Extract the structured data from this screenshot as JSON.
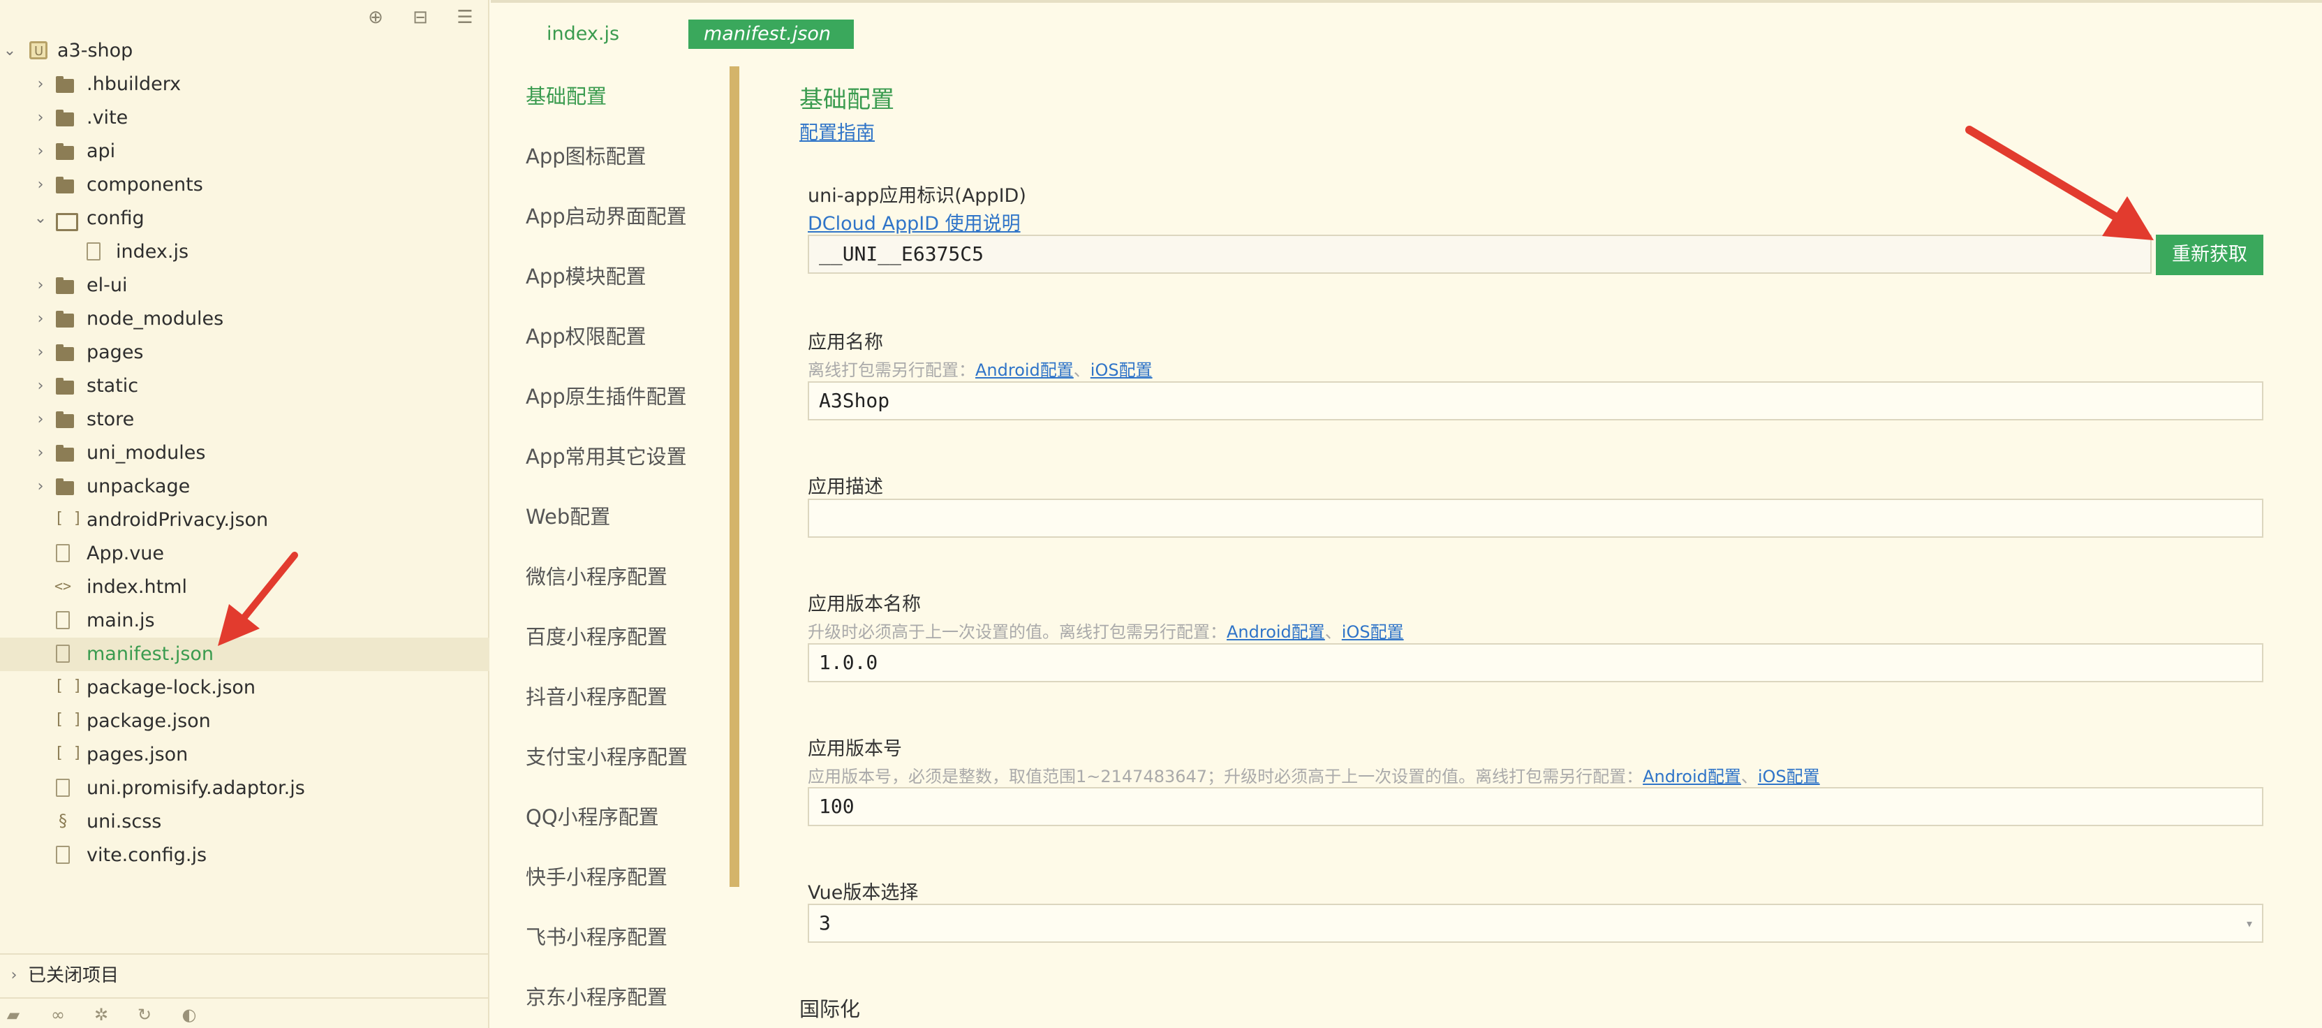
{
  "sidebar": {
    "toolbar_icons": [
      "crosshair-icon",
      "collapse-icon",
      "menu-icon"
    ],
    "tree": [
      {
        "label": "a3-shop",
        "type": "project",
        "depth": 0,
        "expanded": true
      },
      {
        "label": ".hbuilderx",
        "type": "folder",
        "depth": 1
      },
      {
        "label": ".vite",
        "type": "folder",
        "depth": 1
      },
      {
        "label": "api",
        "type": "folder",
        "depth": 1
      },
      {
        "label": "components",
        "type": "folder",
        "depth": 1
      },
      {
        "label": "config",
        "type": "folder",
        "depth": 1,
        "expanded": true
      },
      {
        "label": "index.js",
        "type": "js",
        "depth": 2
      },
      {
        "label": "el-ui",
        "type": "folder",
        "depth": 1
      },
      {
        "label": "node_modules",
        "type": "folder",
        "depth": 1
      },
      {
        "label": "pages",
        "type": "folder",
        "depth": 1
      },
      {
        "label": "static",
        "type": "folder",
        "depth": 1
      },
      {
        "label": "store",
        "type": "folder",
        "depth": 1
      },
      {
        "label": "uni_modules",
        "type": "folder",
        "depth": 1
      },
      {
        "label": "unpackage",
        "type": "folder",
        "depth": 1
      },
      {
        "label": "androidPrivacy.json",
        "type": "json",
        "depth": 1
      },
      {
        "label": "App.vue",
        "type": "vue",
        "depth": 1
      },
      {
        "label": "index.html",
        "type": "html",
        "depth": 1
      },
      {
        "label": "main.js",
        "type": "js",
        "depth": 1
      },
      {
        "label": "manifest.json",
        "type": "manifest",
        "depth": 1,
        "active": true
      },
      {
        "label": "package-lock.json",
        "type": "json",
        "depth": 1
      },
      {
        "label": "package.json",
        "type": "json",
        "depth": 1
      },
      {
        "label": "pages.json",
        "type": "json",
        "depth": 1
      },
      {
        "label": "uni.promisify.adaptor.js",
        "type": "js",
        "depth": 1
      },
      {
        "label": "uni.scss",
        "type": "scss",
        "depth": 1
      },
      {
        "label": "vite.config.js",
        "type": "js",
        "depth": 1
      }
    ],
    "closed_projects_label": "已关闭项目",
    "bottom_icons": [
      "folder-icon",
      "bicycle-icon",
      "bug-icon",
      "refresh-icon",
      "palette-icon"
    ]
  },
  "tabs": [
    {
      "label": "index.js",
      "active": false
    },
    {
      "label": "manifest.json",
      "active": true
    }
  ],
  "nav": {
    "items": [
      {
        "label": "基础配置",
        "active": true
      },
      {
        "label": "App图标配置"
      },
      {
        "label": "App启动界面配置"
      },
      {
        "label": "App模块配置"
      },
      {
        "label": "App权限配置"
      },
      {
        "label": "App原生插件配置"
      },
      {
        "label": "App常用其它设置"
      },
      {
        "label": "Web配置"
      },
      {
        "label": "微信小程序配置"
      },
      {
        "label": "百度小程序配置"
      },
      {
        "label": "抖音小程序配置"
      },
      {
        "label": "支付宝小程序配置"
      },
      {
        "label": "QQ小程序配置"
      },
      {
        "label": "快手小程序配置"
      },
      {
        "label": "飞书小程序配置"
      },
      {
        "label": "京东小程序配置"
      }
    ]
  },
  "content": {
    "title": "基础配置",
    "guide_link": "配置指南",
    "appid": {
      "label": "uni-app应用标识(AppID)",
      "help_link": "DCloud AppID 使用说明",
      "value": "__UNI__E6375C5",
      "button": "重新获取"
    },
    "app_name": {
      "label": "应用名称",
      "hint": "离线打包需另行配置：",
      "android_link": "Android配置",
      "sep": "、",
      "ios_link": "iOS配置",
      "value": "A3Shop"
    },
    "app_desc": {
      "label": "应用描述",
      "value": ""
    },
    "version_name": {
      "label": "应用版本名称",
      "hint": "升级时必须高于上一次设置的值。离线打包需另行配置：",
      "android_link": "Android配置",
      "sep": "、",
      "ios_link": "iOS配置",
      "value": "1.0.0"
    },
    "version_code": {
      "label": "应用版本号",
      "hint": "应用版本号，必须是整数，取值范围1~2147483647；升级时必须高于上一次设置的值。离线打包需另行配置：",
      "android_link": "Android配置",
      "sep": "、",
      "ios_link": "iOS配置",
      "value": "100"
    },
    "vue_version": {
      "label": "Vue版本选择",
      "value": "3"
    },
    "i18n": {
      "label": "国际化"
    }
  },
  "colors": {
    "accent_green": "#3aa85c",
    "link_blue": "#2f74c8",
    "arrow_red": "#e23b2e",
    "background": "#fefae8"
  }
}
